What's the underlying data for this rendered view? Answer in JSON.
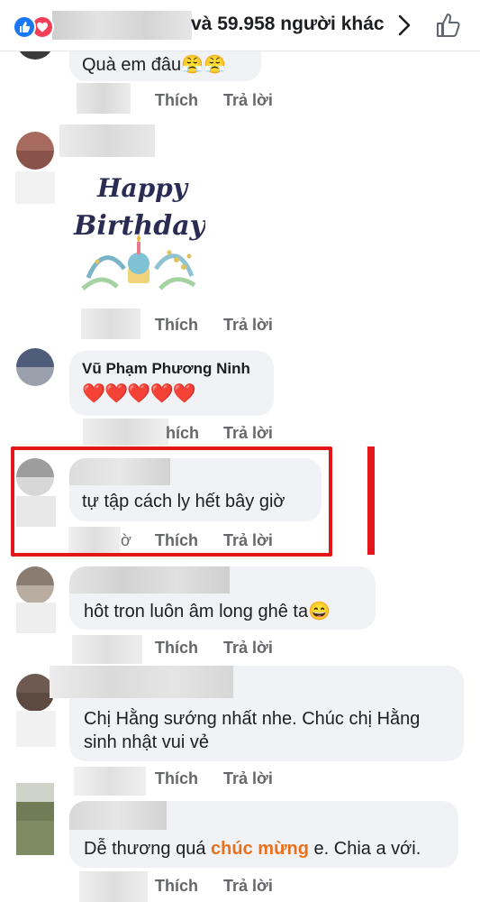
{
  "header": {
    "reactions_text": "và 59.958 người khác",
    "icons": [
      "like-reaction-icon",
      "love-reaction-icon",
      "chevron-right-icon",
      "thumbs-up-icon"
    ]
  },
  "comments": [
    {
      "text": "Quà em đâu😤😤",
      "like_label": "Thích",
      "reply_label": "Trả lời"
    },
    {
      "sticker": "Happy Birthday",
      "sticker_line1": "Happy",
      "sticker_line2": "Birthday",
      "like_label": "Thích",
      "reply_label": "Trả lời"
    },
    {
      "author": "Vũ Phạm Phương Ninh",
      "text": "❤️❤️❤️❤️❤️",
      "time_fragment": "hích",
      "reply_label": "Trả lời"
    },
    {
      "text": "tự tập cách ly hết bây giờ",
      "time_fragment": "ờ",
      "like_label": "Thích",
      "reply_label": "Trả lời",
      "highlighted": true
    },
    {
      "text": "hôt tron luôn âm long ghê ta😄",
      "like_label": "Thích",
      "reply_label": "Trả lời"
    },
    {
      "text_line1": "Chị Hằng sướng nhất nhe. Chúc chị Hằng",
      "text_line2": "sinh nhật vui vẻ",
      "like_label": "Thích",
      "reply_label": "Trả lời"
    },
    {
      "text_before": "Dễ thương quá ",
      "text_highlight": "chúc mừng",
      "text_after": " e. Chia a với.",
      "highlight_color": "#e9711c",
      "like_label": "Thích",
      "reply_label": "Trả lời"
    }
  ],
  "colors": {
    "accent_blue": "#1877f2",
    "love_red": "#f33e58",
    "frame_red": "#e4161b",
    "bubble_bg": "#f0f2f5",
    "action_gray": "#65676b"
  }
}
